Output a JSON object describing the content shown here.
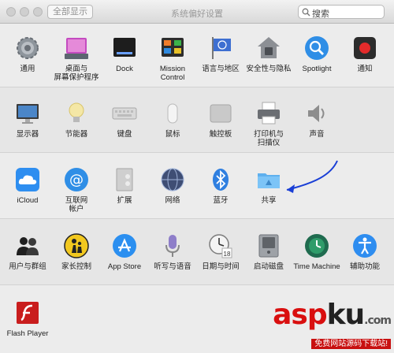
{
  "window": {
    "title": "系统偏好设置"
  },
  "toolbar": {
    "show_all": "全部显示",
    "back": "‹",
    "forward": "›"
  },
  "search": {
    "placeholder": "搜索"
  },
  "rows": [
    [
      {
        "label": "通用"
      },
      {
        "label": "桌面与\n屏幕保护程序"
      },
      {
        "label": "Dock"
      },
      {
        "label": "Mission\nControl"
      },
      {
        "label": "语言与地区"
      },
      {
        "label": "安全性与隐私"
      },
      {
        "label": "Spotlight"
      },
      {
        "label": "通知"
      }
    ],
    [
      {
        "label": "显示器"
      },
      {
        "label": "节能器"
      },
      {
        "label": "键盘"
      },
      {
        "label": "鼠标"
      },
      {
        "label": "触控板"
      },
      {
        "label": "打印机与\n扫描仪"
      },
      {
        "label": "声音"
      }
    ],
    [
      {
        "label": "iCloud"
      },
      {
        "label": "互联网\n帐户"
      },
      {
        "label": "扩展"
      },
      {
        "label": "网络"
      },
      {
        "label": "蓝牙"
      },
      {
        "label": "共享"
      }
    ],
    [
      {
        "label": "用户与群组"
      },
      {
        "label": "家长控制"
      },
      {
        "label": "App Store"
      },
      {
        "label": "听写与语音"
      },
      {
        "label": "日期与时间"
      },
      {
        "label": "启动磁盘"
      },
      {
        "label": "Time Machine"
      },
      {
        "label": "辅助功能"
      }
    ],
    [
      {
        "label": "Flash Player"
      }
    ]
  ],
  "watermark": {
    "main": "asp",
    "k": "ku",
    "tld": ".com",
    "sub": "免费网站源码下载站!"
  },
  "accent": "#1a3fd6"
}
